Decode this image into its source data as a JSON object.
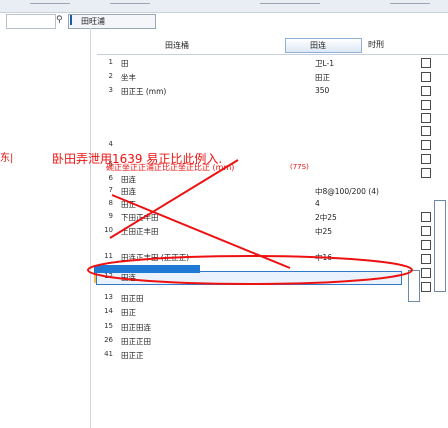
{
  "tab": {
    "title": "田旺浦"
  },
  "header": {
    "name_col": "田连桶",
    "value_col": "田连桶",
    "button_label": "田连",
    "last_col": "时刑"
  },
  "annotation": {
    "big_text": "卧田弄泄用1639 易正比此例入.",
    "sub_text": "碗正坐正正浦正比正坐正比正 (mm)",
    "value_hint": "(77S)",
    "left_mark": "东|"
  },
  "rows": [
    {
      "n": "1",
      "name": "田",
      "value": "卫L-1"
    },
    {
      "n": "2",
      "name": "坐丰",
      "value": "田正"
    },
    {
      "n": "3",
      "name": "田正王 (mm)",
      "value": "350"
    },
    {
      "n": "4",
      "name": "",
      "value": ""
    },
    {
      "n": "5",
      "name": "",
      "value": ""
    },
    {
      "n": "6",
      "name": "田连",
      "value": ""
    },
    {
      "n": "7",
      "name": "田连",
      "value": "中8@100/200 (4)"
    },
    {
      "n": "8",
      "name": "田正",
      "value": "4"
    },
    {
      "n": "9",
      "name": "下田正丰田",
      "value": "2中25"
    },
    {
      "n": "10",
      "name": "上田正丰田",
      "value": "中25"
    },
    {
      "n": "11",
      "name": "田连正丰田 (正正正)",
      "value": "中16"
    },
    {
      "n": "12",
      "name": "田连",
      "value": ""
    },
    {
      "n": "13",
      "name": "田正田",
      "value": ""
    },
    {
      "n": "14",
      "name": "田正",
      "value": ""
    },
    {
      "n": "15",
      "name": "田正田连",
      "value": ""
    },
    {
      "n": "26",
      "name": "田正正田",
      "value": ""
    },
    {
      "n": "41",
      "name": "田正正",
      "value": ""
    }
  ]
}
